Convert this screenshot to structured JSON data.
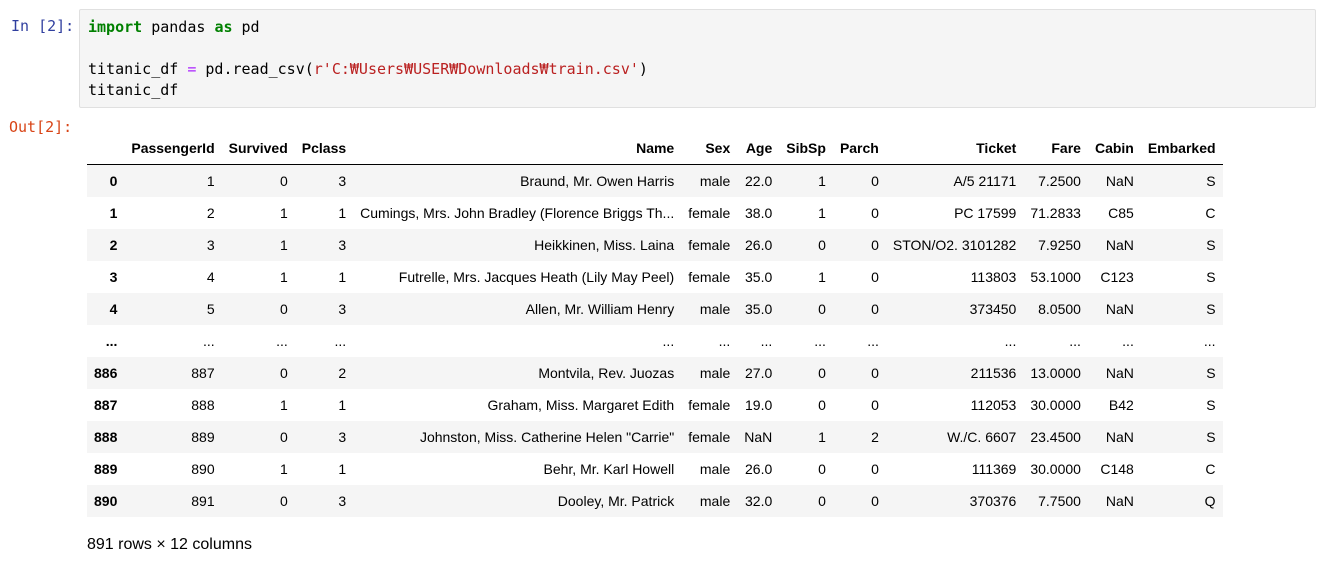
{
  "input_prompt": "In [2]:",
  "output_prompt": "Out[2]:",
  "code": {
    "line1": {
      "kw1": "import",
      "t1": " pandas ",
      "kw2": "as",
      "t2": " pd"
    },
    "line3": {
      "t1": "titanic_df ",
      "op": "=",
      "t2": " pd.read_csv(",
      "str": "r'C:₩Users₩USER₩Downloads₩train.csv'",
      "t3": ")"
    },
    "line4": "titanic_df"
  },
  "table": {
    "columns": [
      "",
      "PassengerId",
      "Survived",
      "Pclass",
      "Name",
      "Sex",
      "Age",
      "SibSp",
      "Parch",
      "Ticket",
      "Fare",
      "Cabin",
      "Embarked"
    ],
    "rows": [
      [
        "0",
        "1",
        "0",
        "3",
        "Braund, Mr. Owen Harris",
        "male",
        "22.0",
        "1",
        "0",
        "A/5 21171",
        "7.2500",
        "NaN",
        "S"
      ],
      [
        "1",
        "2",
        "1",
        "1",
        "Cumings, Mrs. John Bradley (Florence Briggs Th...",
        "female",
        "38.0",
        "1",
        "0",
        "PC 17599",
        "71.2833",
        "C85",
        "C"
      ],
      [
        "2",
        "3",
        "1",
        "3",
        "Heikkinen, Miss. Laina",
        "female",
        "26.0",
        "0",
        "0",
        "STON/O2. 3101282",
        "7.9250",
        "NaN",
        "S"
      ],
      [
        "3",
        "4",
        "1",
        "1",
        "Futrelle, Mrs. Jacques Heath (Lily May Peel)",
        "female",
        "35.0",
        "1",
        "0",
        "113803",
        "53.1000",
        "C123",
        "S"
      ],
      [
        "4",
        "5",
        "0",
        "3",
        "Allen, Mr. William Henry",
        "male",
        "35.0",
        "0",
        "0",
        "373450",
        "8.0500",
        "NaN",
        "S"
      ],
      [
        "...",
        "...",
        "...",
        "...",
        "...",
        "...",
        "...",
        "...",
        "...",
        "...",
        "...",
        "...",
        "..."
      ],
      [
        "886",
        "887",
        "0",
        "2",
        "Montvila, Rev. Juozas",
        "male",
        "27.0",
        "0",
        "0",
        "211536",
        "13.0000",
        "NaN",
        "S"
      ],
      [
        "887",
        "888",
        "1",
        "1",
        "Graham, Miss. Margaret Edith",
        "female",
        "19.0",
        "0",
        "0",
        "112053",
        "30.0000",
        "B42",
        "S"
      ],
      [
        "888",
        "889",
        "0",
        "3",
        "Johnston, Miss. Catherine Helen \"Carrie\"",
        "female",
        "NaN",
        "1",
        "2",
        "W./C. 6607",
        "23.4500",
        "NaN",
        "S"
      ],
      [
        "889",
        "890",
        "1",
        "1",
        "Behr, Mr. Karl Howell",
        "male",
        "26.0",
        "0",
        "0",
        "111369",
        "30.0000",
        "C148",
        "C"
      ],
      [
        "890",
        "891",
        "0",
        "3",
        "Dooley, Mr. Patrick",
        "male",
        "32.0",
        "0",
        "0",
        "370376",
        "7.7500",
        "NaN",
        "Q"
      ]
    ]
  },
  "summary": "891 rows × 12 columns"
}
